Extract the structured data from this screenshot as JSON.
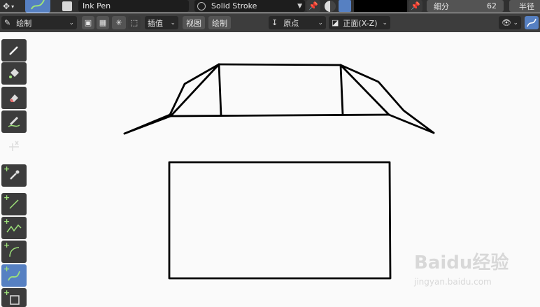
{
  "top_bar": {
    "brush_name": "Ink Pen",
    "material_name": "Solid Stroke",
    "subdivide_label": "细分",
    "subdivide_value": "62",
    "radius_label": "半径"
  },
  "second_bar": {
    "mode_label": "绘制",
    "interpolate_label": "插值",
    "view_label": "视图",
    "draw_label": "绘制",
    "origin_label": "原点",
    "plane_label": "正面(X-Z)"
  },
  "colors": {
    "header_bg": "#303030",
    "canvas_bg": "#fafafa",
    "active_tool": "#5680c2",
    "accent_green": "#9ee27a",
    "stroke": "#000000"
  },
  "toolbar_tools": [
    {
      "icon": "draw-pencil-icon"
    },
    {
      "icon": "fill-bucket-icon"
    },
    {
      "icon": "eraser-icon"
    },
    {
      "icon": "tint-brush-icon"
    },
    {
      "icon": "cutter-scissors-icon"
    },
    {
      "icon": "eyedropper-icon"
    },
    {
      "icon": "line-icon"
    },
    {
      "icon": "polyline-icon"
    },
    {
      "icon": "arc-icon"
    },
    {
      "icon": "curve-icon"
    },
    {
      "icon": "box-icon"
    }
  ],
  "watermark": {
    "brand": "Baidu经验",
    "url": "jingyan.baidu.com"
  }
}
